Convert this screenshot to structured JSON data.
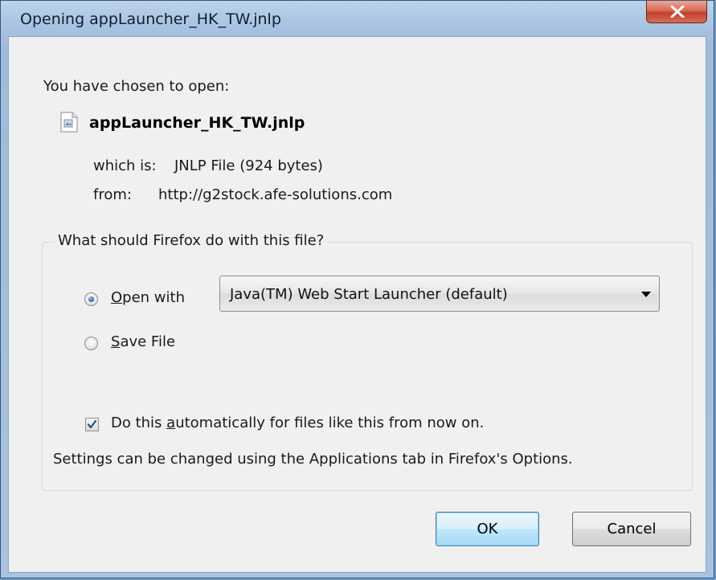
{
  "window": {
    "title": "Opening appLauncher_HK_TW.jnlp",
    "close_label": "×"
  },
  "dialog": {
    "prompt": "You have chosen to open:",
    "file_name": "appLauncher_HK_TW.jnlp",
    "which_is_label": "which is:",
    "which_is_value": "JNLP File (924 bytes)",
    "from_label": "from:",
    "from_value": "http://g2stock.afe-solutions.com"
  },
  "action_group": {
    "legend": "What should Firefox do with this file?",
    "open_with": {
      "mnemonic": "O",
      "rest": "pen with",
      "selected": true
    },
    "app_select": {
      "selected_value": "Java(TM) Web Start Launcher (default)"
    },
    "save_file": {
      "mnemonic": "S",
      "rest": "ave File",
      "selected": false
    },
    "auto_checkbox": {
      "prefix": "Do this ",
      "mnemonic": "a",
      "suffix": "utomatically for files like this from now on.",
      "checked": true
    },
    "settings_note": "Settings can be changed using the Applications tab in Firefox's Options."
  },
  "buttons": {
    "ok_label": "OK",
    "cancel_label": "Cancel"
  },
  "colors": {
    "title_bar": "#a9c4e1",
    "close_button": "#c8452f",
    "dialog_bg": "#f0f0f0",
    "default_button_border": "#3c7fb1"
  },
  "icons": {
    "file": "generic-file-icon",
    "close": "close-icon",
    "dropdown": "chevron-down-icon",
    "check": "check-icon"
  }
}
